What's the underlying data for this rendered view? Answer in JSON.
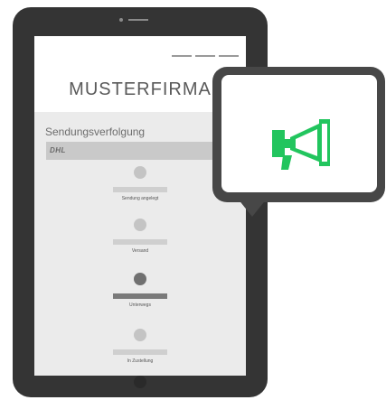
{
  "screen": {
    "company_name": "MUSTERFIRMA",
    "section_title": "Sendungsverfolgung",
    "carrier_logo": "DHL"
  },
  "tracking_steps": [
    {
      "label": "Sendung angelegt",
      "state": "inactive"
    },
    {
      "label": "Versand",
      "state": "inactive"
    },
    {
      "label": "Unterwegs",
      "state": "active"
    },
    {
      "label": "In Zustellung",
      "state": "inactive"
    }
  ],
  "popup": {
    "icon": "megaphone-icon"
  },
  "colors": {
    "device_frame": "#343434",
    "popup_frame": "#474747",
    "accent_green": "#22c55e",
    "content_bg": "#ebebeb"
  }
}
